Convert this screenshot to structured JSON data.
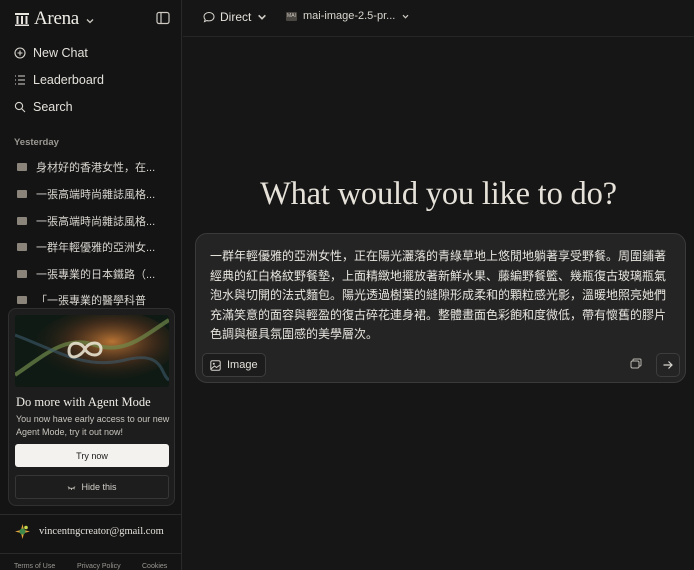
{
  "brand": {
    "name": "Arena"
  },
  "nav": [
    {
      "label": "New Chat",
      "icon": "plus-circle-icon"
    },
    {
      "label": "Leaderboard",
      "icon": "leaderboard-icon"
    },
    {
      "label": "Search",
      "icon": "search-icon"
    }
  ],
  "history": {
    "section": "Yesterday",
    "items": [
      "身材好的香港女性，在...",
      "一張高端時尚雜誌風格...",
      "一張高端時尚雜誌風格...",
      "一群年輕優雅的亞洲女...",
      "一張專業的日本鐵路（...",
      "「一張專業的醫學科普"
    ]
  },
  "agent_card": {
    "title": "Do more with Agent Mode",
    "description": "You now have early access to our new Agent Mode, try it out now!",
    "try_label": "Try now",
    "hide_label": "Hide this"
  },
  "account": {
    "email": "vincentngcreator@gmail.com"
  },
  "footer": [
    "Terms of Use",
    "Privacy Policy",
    "Cookies"
  ],
  "topbar": {
    "mode": "Direct",
    "model": "mai-image-2.5-pr...",
    "model_logo_text": "MAI"
  },
  "headline": "What would you like to do?",
  "composer": {
    "prompt": "一群年輕優雅的亞洲女性，正在陽光灑落的青綠草地上悠閒地躺著享受野餐。周圍鋪著經典的紅白格紋野餐墊，上面精緻地擺放著新鮮水果、藤編野餐籃、幾瓶復古玻璃瓶氣泡水與切開的法式麵包。陽光透過樹葉的縫隙形成柔和的顆粒感光影，溫暖地照亮她們充滿笑意的面容與輕盈的復古碎花連身裙。整體畫面色彩飽和度微低，帶有懷舊的膠片色調與極具氛圍感的美學層次。",
    "image_label": "Image"
  },
  "colors": {
    "background": "#161616",
    "sidebar": "#141414",
    "composer": "#242424",
    "accent_button": "#f4f2ee"
  }
}
